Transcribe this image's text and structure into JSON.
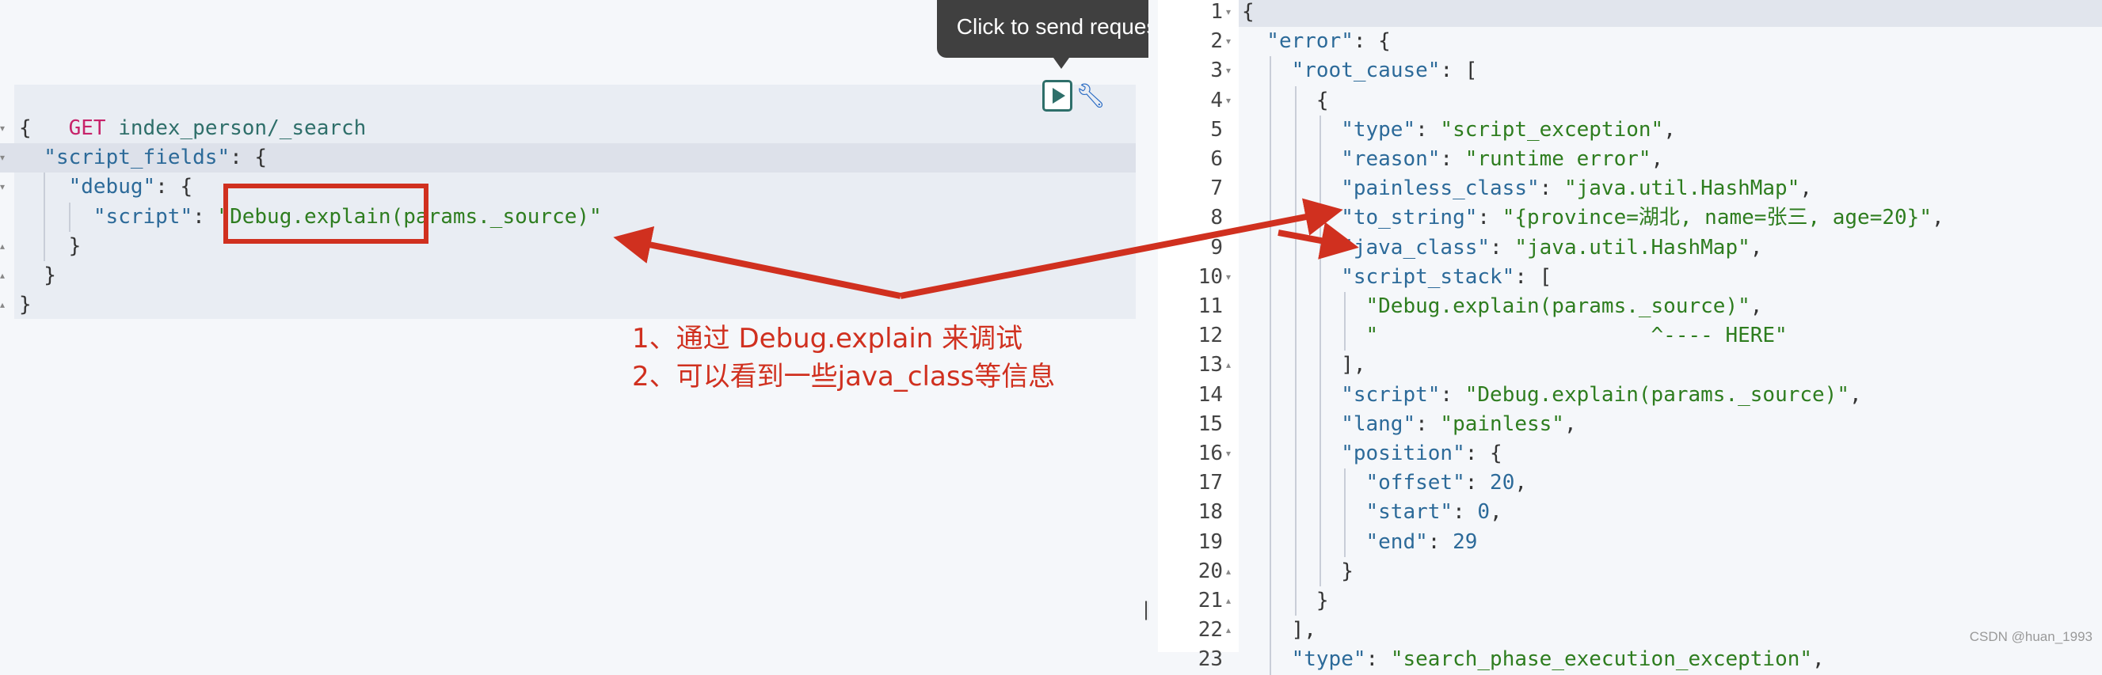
{
  "request": {
    "method": "GET",
    "path": " index_person/_search",
    "body_lines": [
      {
        "indent": 0,
        "text": "{",
        "fold": "▾"
      },
      {
        "indent": 1,
        "text": "\"script_fields\": {",
        "fold": "▾"
      },
      {
        "indent": 2,
        "text": "\"debug\": {",
        "fold": "▾"
      },
      {
        "indent": 3,
        "text": "\"script\": \"Debug.explain(params._source)\"",
        "fold": ""
      },
      {
        "indent": 2,
        "text": "}",
        "fold": "▴"
      },
      {
        "indent": 1,
        "text": "}",
        "fold": "▴"
      },
      {
        "indent": 0,
        "text": "}",
        "fold": "▴"
      }
    ]
  },
  "tooltip": {
    "text": "Click to send request"
  },
  "icons": {
    "send": "play-icon",
    "settings": "wrench-icon"
  },
  "annotation": {
    "line1": "1、通过 Debug.explain 来调试",
    "line2": "2、可以看到一些java_class等信息",
    "color": "#d0301f"
  },
  "response": {
    "lines": [
      {
        "n": "1",
        "fold": "▾",
        "indent": 0,
        "text": "{"
      },
      {
        "n": "2",
        "fold": "▾",
        "indent": 1,
        "text": "\"error\": {"
      },
      {
        "n": "3",
        "fold": "▾",
        "indent": 2,
        "text": "\"root_cause\": ["
      },
      {
        "n": "4",
        "fold": "▾",
        "indent": 3,
        "text": "{"
      },
      {
        "n": "5",
        "fold": "",
        "indent": 4,
        "text": "\"type\": \"script_exception\","
      },
      {
        "n": "6",
        "fold": "",
        "indent": 4,
        "text": "\"reason\": \"runtime error\","
      },
      {
        "n": "7",
        "fold": "",
        "indent": 4,
        "text": "\"painless_class\": \"java.util.HashMap\","
      },
      {
        "n": "8",
        "fold": "",
        "indent": 4,
        "text": "\"to_string\": \"{province=湖北, name=张三, age=20}\","
      },
      {
        "n": "9",
        "fold": "",
        "indent": 4,
        "text": "\"java_class\": \"java.util.HashMap\","
      },
      {
        "n": "10",
        "fold": "▾",
        "indent": 4,
        "text": "\"script_stack\": ["
      },
      {
        "n": "11",
        "fold": "",
        "indent": 5,
        "text": "\"Debug.explain(params._source)\","
      },
      {
        "n": "12",
        "fold": "",
        "indent": 5,
        "text": "\"                      ^---- HERE\""
      },
      {
        "n": "13",
        "fold": "▴",
        "indent": 4,
        "text": "],"
      },
      {
        "n": "14",
        "fold": "",
        "indent": 4,
        "text": "\"script\": \"Debug.explain(params._source)\","
      },
      {
        "n": "15",
        "fold": "",
        "indent": 4,
        "text": "\"lang\": \"painless\","
      },
      {
        "n": "16",
        "fold": "▾",
        "indent": 4,
        "text": "\"position\": {"
      },
      {
        "n": "17",
        "fold": "",
        "indent": 5,
        "text": "\"offset\": 20,"
      },
      {
        "n": "18",
        "fold": "",
        "indent": 5,
        "text": "\"start\": 0,"
      },
      {
        "n": "19",
        "fold": "",
        "indent": 5,
        "text": "\"end\": 29"
      },
      {
        "n": "20",
        "fold": "▴",
        "indent": 4,
        "text": "}"
      },
      {
        "n": "21",
        "fold": "▴",
        "indent": 3,
        "text": "}"
      },
      {
        "n": "22",
        "fold": "▴",
        "indent": 2,
        "text": "],"
      },
      {
        "n": "23",
        "fold": "",
        "indent": 2,
        "text": "\"type\": \"search_phase_execution_exception\","
      }
    ]
  },
  "splitter": "‖",
  "watermark": "CSDN @huan_1993",
  "colors": {
    "key": "#2c6a99",
    "string": "#2e7d1f",
    "method": "#c7236a",
    "accent": "#2e6f6a"
  }
}
